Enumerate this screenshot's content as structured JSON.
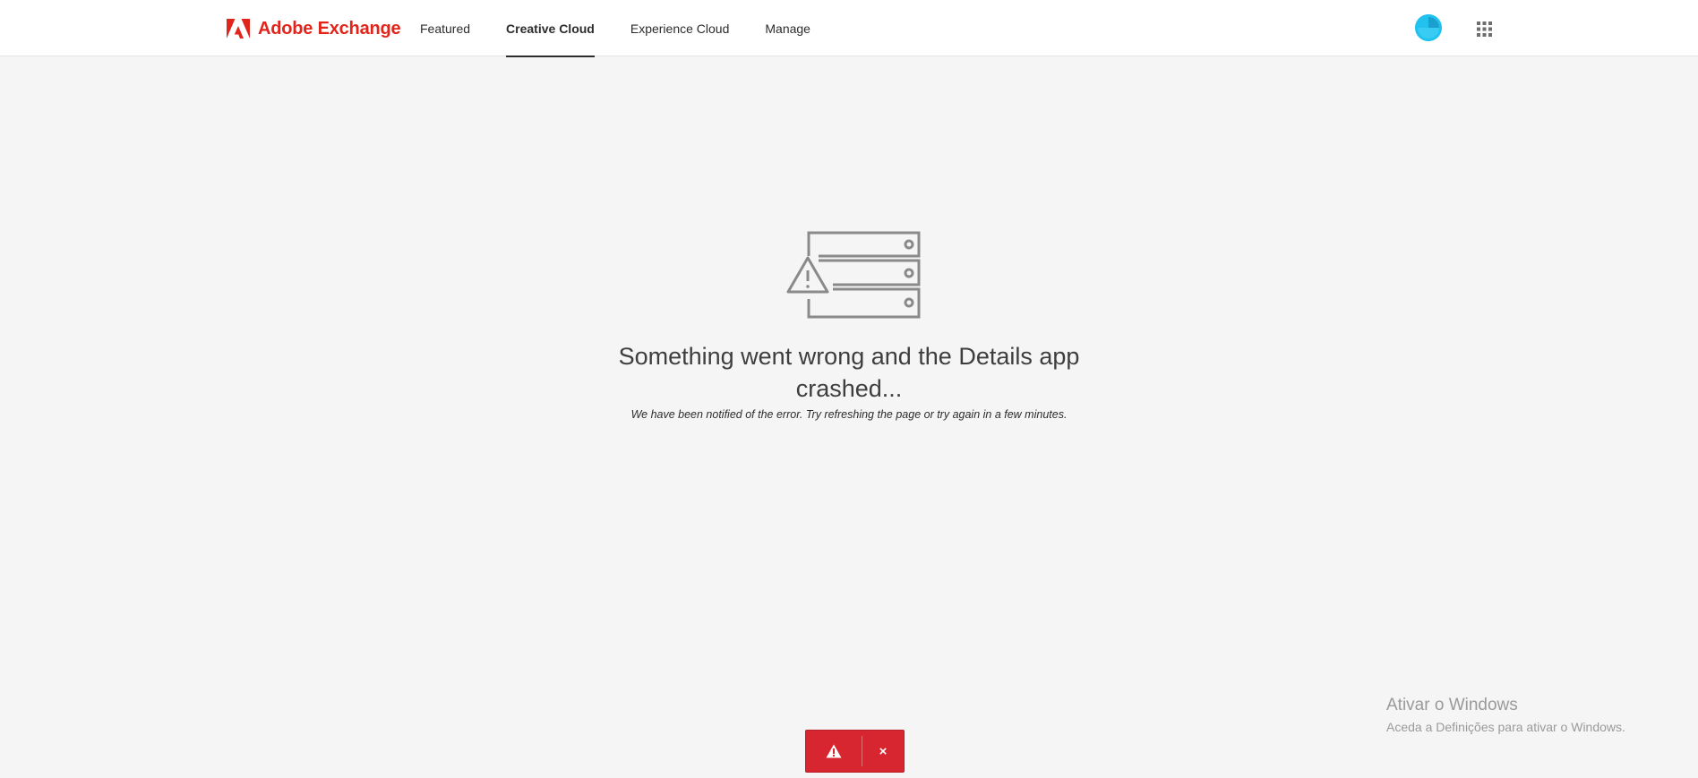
{
  "header": {
    "brand_name": "Adobe Exchange",
    "brand_color": "#e1251b",
    "nav": [
      {
        "label": "Featured",
        "active": false
      },
      {
        "label": "Creative Cloud",
        "active": true
      },
      {
        "label": "Experience Cloud",
        "active": false
      },
      {
        "label": "Manage",
        "active": false
      }
    ],
    "avatar_color": "#21c2ee",
    "apps_icon": "grid-icon"
  },
  "error": {
    "icon": "server-warning-icon",
    "title": "Something went wrong and the Details app crashed...",
    "message": "We have been notified of the error. Try refreshing the page or try again in a few minutes."
  },
  "toast": {
    "icon": "warning-icon",
    "close_label": "×",
    "color": "#d7262f"
  },
  "watermark": {
    "title": "Ativar o Windows",
    "subtitle": "Aceda a Definições para ativar o Windows."
  }
}
